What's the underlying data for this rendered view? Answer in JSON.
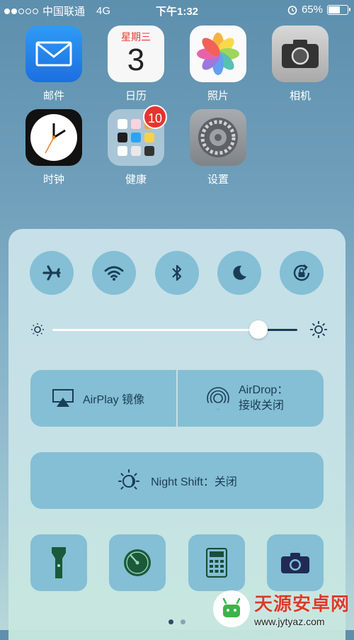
{
  "status_bar": {
    "carrier": "中国联通",
    "network": "4G",
    "time": "下午1:32",
    "battery": "65%",
    "battery_level": 0.65
  },
  "home_apps": [
    {
      "label": "邮件",
      "icon": "mail-icon"
    },
    {
      "label": "日历",
      "icon": "calendar-icon",
      "weekday": "星期三",
      "day": "3"
    },
    {
      "label": "照片",
      "icon": "photos-icon"
    },
    {
      "label": "相机",
      "icon": "camera-icon"
    },
    {
      "label": "时钟",
      "icon": "clock-icon"
    },
    {
      "label": "健康",
      "icon": "folder-icon",
      "badge": "10"
    },
    {
      "label": "设置",
      "icon": "settings-gear-icon"
    }
  ],
  "control_center": {
    "toggles": [
      {
        "name": "airplane-mode",
        "icon": "airplane-icon"
      },
      {
        "name": "wifi",
        "icon": "wifi-icon"
      },
      {
        "name": "bluetooth",
        "icon": "bluetooth-icon"
      },
      {
        "name": "do-not-disturb",
        "icon": "moon-icon"
      },
      {
        "name": "rotation-lock",
        "icon": "rotation-lock-icon"
      }
    ],
    "brightness": 0.84,
    "airplay_label": "AirPlay 镜像",
    "airdrop_line1": "AirDrop：",
    "airdrop_line2": "接收关闭",
    "night_shift_label": "Night Shift：关闭",
    "tools": [
      {
        "name": "flashlight",
        "icon": "flashlight-icon"
      },
      {
        "name": "timer",
        "icon": "timer-icon"
      },
      {
        "name": "calculator",
        "icon": "calculator-icon"
      },
      {
        "name": "camera",
        "icon": "camera-icon"
      }
    ],
    "accent_color": "#84bfd5"
  },
  "page_indicator": {
    "count": 2,
    "active": 0
  },
  "watermark": {
    "title": "天源安卓网",
    "url": "www.jytyaz.com"
  }
}
